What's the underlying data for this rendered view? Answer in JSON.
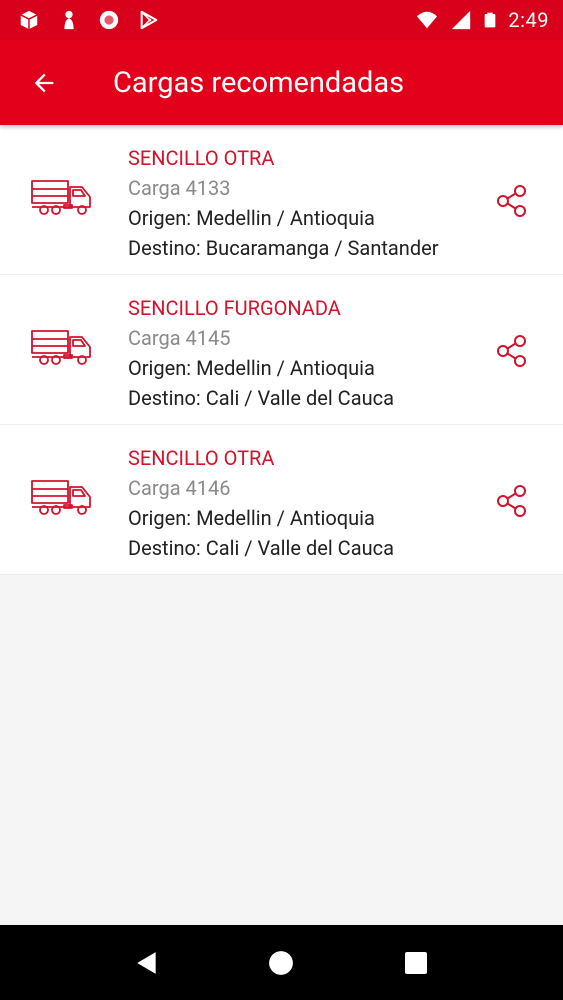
{
  "status_bar": {
    "time": "2:49",
    "left_icons": [
      "box-icon",
      "pawn-icon",
      "record-icon",
      "play-store-icon"
    ],
    "right_icons": [
      "wifi-icon",
      "signal-icon",
      "battery-icon"
    ]
  },
  "app_bar": {
    "title": "Cargas recomendadas",
    "back_icon": "arrow-back-icon"
  },
  "cargas": [
    {
      "type": "SENCILLO OTRA",
      "carga": "Carga 4133",
      "origen": "Origen: Medellin / Antioquia",
      "destino": "Destino: Bucaramanga / Santander"
    },
    {
      "type": "SENCILLO FURGONADA",
      "carga": "Carga 4145",
      "origen": "Origen: Medellin / Antioquia",
      "destino": "Destino: Cali / Valle del Cauca"
    },
    {
      "type": "SENCILLO OTRA",
      "carga": "Carga 4146",
      "origen": "Origen: Medellin / Antioquia",
      "destino": "Destino: Cali / Valle del Cauca"
    }
  ],
  "colors": {
    "primary": "#e3001b",
    "status_bar": "#d9001b",
    "accent_text": "#d3122c",
    "secondary_text": "#8a8a8a"
  },
  "nav_bar": {
    "icons": [
      "back-triangle-icon",
      "home-circle-icon",
      "recents-square-icon"
    ]
  }
}
